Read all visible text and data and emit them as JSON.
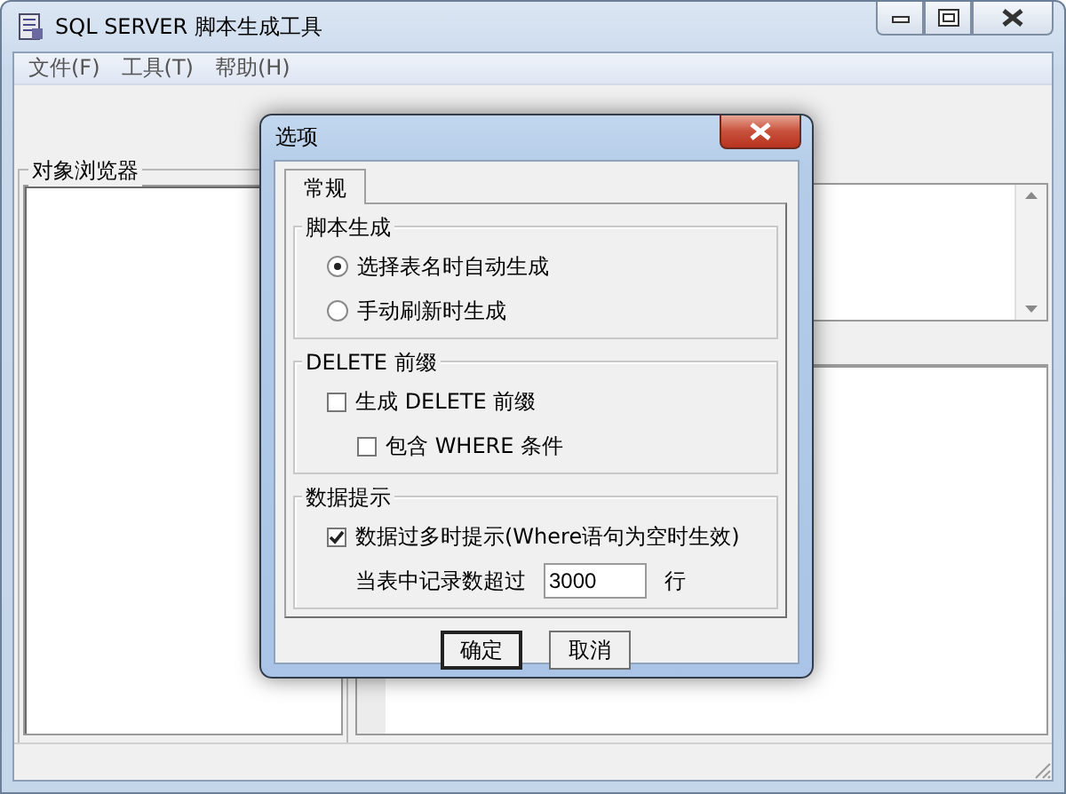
{
  "window": {
    "title": "SQL SERVER 脚本生成工具"
  },
  "menu": [
    {
      "label": "文件(F)"
    },
    {
      "label": "工具(T)"
    },
    {
      "label": "帮助(H)"
    }
  ],
  "object_browser": {
    "title": "对象浏览器"
  },
  "dialog": {
    "title": "选项",
    "tabs": [
      {
        "label": "常规",
        "selected": true
      }
    ],
    "groups": [
      {
        "title": "脚本生成",
        "items": [
          {
            "kind": "radio",
            "label": "选择表名时自动生成",
            "selected": true
          },
          {
            "kind": "radio",
            "label": "手动刷新时生成",
            "selected": false
          }
        ]
      },
      {
        "title": "DELETE 前缀",
        "items": [
          {
            "kind": "checkbox",
            "label": "生成 DELETE 前缀",
            "checked": false,
            "children": [
              {
                "kind": "checkbox",
                "label": "包含 WHERE 条件",
                "checked": false
              }
            ]
          }
        ]
      },
      {
        "title": "数据提示",
        "items": [
          {
            "kind": "checkbox",
            "label": "数据过多时提示(Where语句为空时生效)",
            "checked": true
          },
          {
            "kind": "number",
            "label": "当表中记录数超过",
            "value": "3000",
            "unit": "行"
          }
        ]
      }
    ],
    "buttons": [
      {
        "label": "确定",
        "default": true
      },
      {
        "label": "取消",
        "default": false
      }
    ]
  }
}
